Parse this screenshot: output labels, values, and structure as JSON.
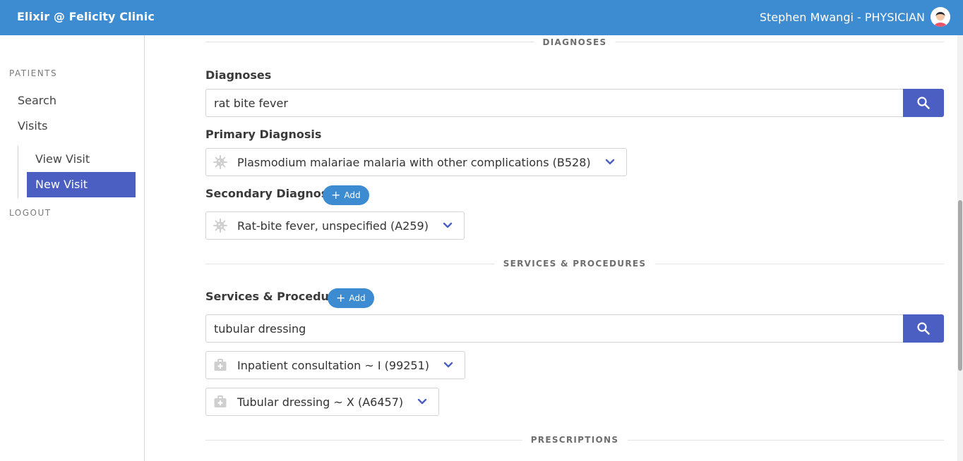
{
  "header": {
    "app_title": "Elixir @ Felicity Clinic",
    "user": "Stephen Mwangi - PHYSICIAN",
    "avatar_icon": "user-avatar-icon"
  },
  "sidebar": {
    "section_label": "PATIENTS",
    "items": [
      {
        "label": "Search"
      },
      {
        "label": "Visits"
      }
    ],
    "sub_items": [
      {
        "label": "View Visit",
        "active": false
      },
      {
        "label": "New Visit",
        "active": true
      }
    ],
    "logout_label": "LOGOUT"
  },
  "main": {
    "diagnoses_section": {
      "heading": "DIAGNOSES",
      "diagnoses_label": "Diagnoses",
      "search_value": "rat bite fever",
      "primary_label": "Primary Diagnosis",
      "primary_value": "Plasmodium malariae malaria with other complications (B528)",
      "secondary_label": "Secondary Diagnoses",
      "add_label": "Add",
      "secondary_items": [
        {
          "label": "Rat-bite fever, unspecified (A259)",
          "icon": "virus-icon"
        }
      ]
    },
    "services_section": {
      "heading": "SERVICES & PROCEDURES",
      "label": "Services & Procedures",
      "add_label": "Add",
      "search_value": "tubular dressing",
      "items": [
        {
          "label": "Inpatient consultation ~ I (99251)",
          "icon": "medical-kit-icon"
        },
        {
          "label": "Tubular dressing ~ X (A6457)",
          "icon": "medical-kit-icon"
        }
      ]
    },
    "prescriptions_section": {
      "heading": "PRESCRIPTIONS"
    }
  },
  "colors": {
    "topbar": "#3d8bd0",
    "active_item": "#4a5fc1",
    "search_button": "#4a5fc1",
    "add_button": "#3d8bd0"
  }
}
